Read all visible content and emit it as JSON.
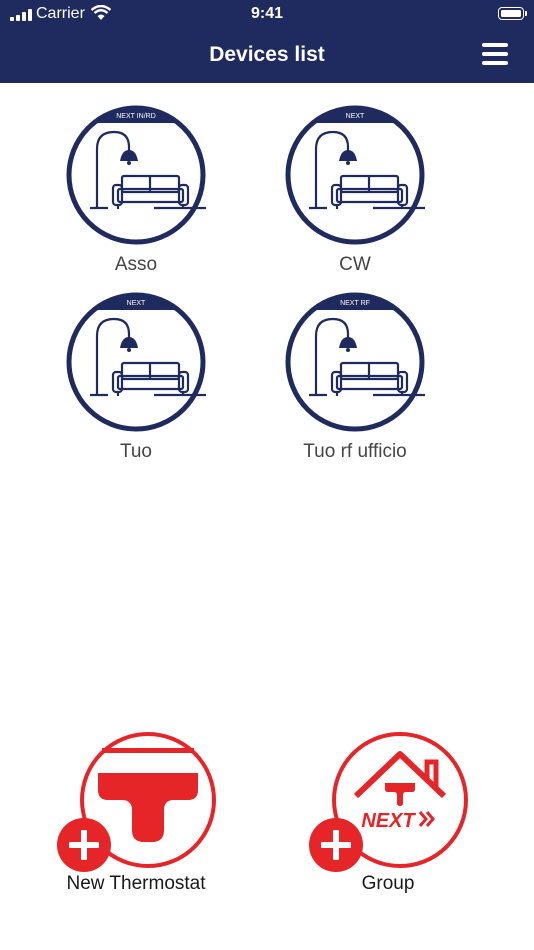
{
  "status_bar": {
    "carrier": "Carrier",
    "time": "9:41"
  },
  "header": {
    "title": "Devices list",
    "menu_icon": "hamburger-menu-icon"
  },
  "devices": [
    {
      "model": "NEXT IN/RD",
      "name": "Asso"
    },
    {
      "model": "NEXT",
      "name": "CW"
    },
    {
      "model": "NEXT",
      "name": "Tuo"
    },
    {
      "model": "NEXT RF",
      "name": "Tuo rf ufficio"
    }
  ],
  "actions": {
    "new_thermostat": {
      "label": "New Thermostat",
      "icon": "thermostat-logo-add-icon"
    },
    "group": {
      "label": "Group",
      "icon": "next-house-add-icon",
      "logo_text": "NEXT"
    }
  },
  "colors": {
    "navy": "#1f2a5e",
    "brand_red": "#e52528",
    "text_gray": "#454545"
  }
}
